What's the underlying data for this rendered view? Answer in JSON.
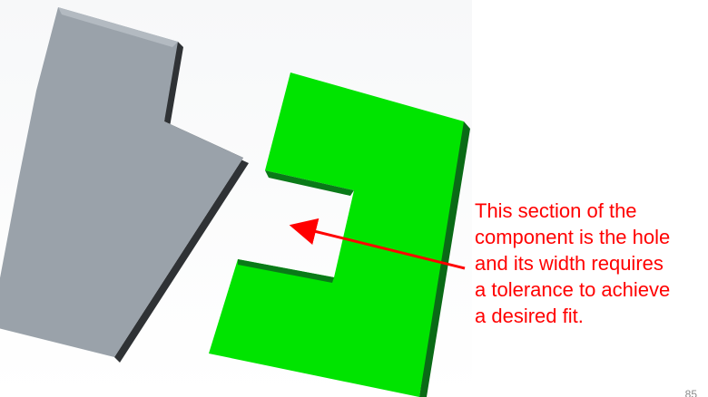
{
  "diagram": {
    "components": [
      {
        "name": "Peg component",
        "color": "#9aa2aa",
        "shadow": "#3a3d40"
      },
      {
        "name": "Hole component",
        "color": "#00e400",
        "shadow": "#0a6a16"
      }
    ],
    "arrow_color": "#ff0000"
  },
  "callout": {
    "lines": [
      "This section of the",
      "component is the hole",
      "and its width requires",
      "a tolerance to achieve",
      "a desired fit."
    ]
  },
  "page_number": "85"
}
